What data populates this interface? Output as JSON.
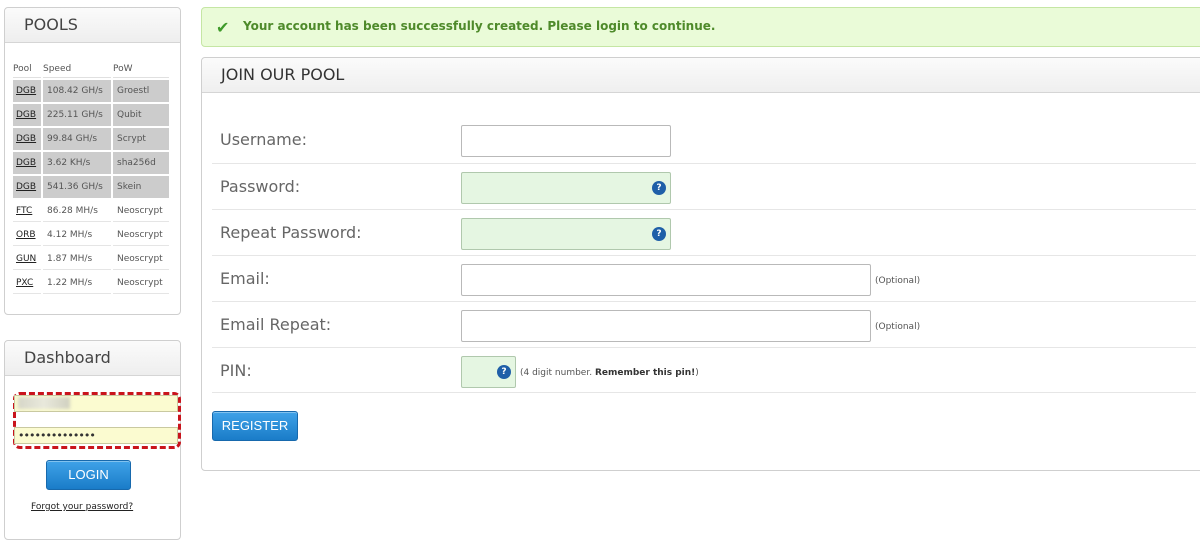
{
  "pools": {
    "title": "POOLS",
    "headers": [
      "Pool",
      "Speed",
      "PoW"
    ],
    "rows": [
      {
        "coin": "DGB",
        "speed": "108.42 GH/s",
        "pow": "Groestl"
      },
      {
        "coin": "DGB",
        "speed": "225.11 GH/s",
        "pow": "Qubit"
      },
      {
        "coin": "DGB",
        "speed": "99.84 GH/s",
        "pow": "Scrypt"
      },
      {
        "coin": "DGB",
        "speed": "3.62 KH/s",
        "pow": "sha256d"
      },
      {
        "coin": "DGB",
        "speed": "541.36 GH/s",
        "pow": "Skein"
      },
      {
        "coin": "FTC",
        "speed": "86.28 MH/s",
        "pow": "Neoscrypt"
      },
      {
        "coin": "ORB",
        "speed": "4.12 MH/s",
        "pow": "Neoscrypt"
      },
      {
        "coin": "GUN",
        "speed": "1.87 MH/s",
        "pow": "Neoscrypt"
      },
      {
        "coin": "PXC",
        "speed": "1.22 MH/s",
        "pow": "Neoscrypt"
      }
    ]
  },
  "dashboard": {
    "title": "Dashboard",
    "password_mask": "••••••••••••••",
    "login_label": "LOGIN",
    "forgot_label": "Forgot your password?"
  },
  "alert": {
    "icon": "check-icon",
    "message": "Your account has been successfully created. Please login to continue."
  },
  "join": {
    "title": "JOIN OUR POOL",
    "fields": {
      "username": {
        "label": "Username:"
      },
      "password": {
        "label": "Password:"
      },
      "repeat_password": {
        "label": "Repeat Password:"
      },
      "email": {
        "label": "Email:",
        "hint": "(Optional)"
      },
      "email_repeat": {
        "label": "Email Repeat:",
        "hint": "(Optional)"
      },
      "pin": {
        "label": "PIN:",
        "hint_prefix": "(4 digit number. ",
        "hint_bold": "Remember this pin!",
        "hint_suffix": ")"
      }
    },
    "register_label": "REGISTER"
  },
  "colors": {
    "alert_bg": "#eafbd8",
    "alert_text": "#4e8a2a",
    "button_blue": "#1f86d4",
    "highlight_red": "#c9141c",
    "field_green": "#e5f6e2",
    "autofill_yellow": "#fbfbd0"
  }
}
